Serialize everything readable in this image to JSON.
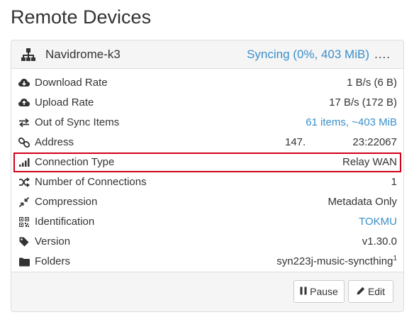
{
  "page": {
    "title": "Remote Devices"
  },
  "device": {
    "name": "Navidrome-k3",
    "status": "Syncing (0%, 403 MiB)",
    "status_more": "...."
  },
  "rows": [
    {
      "icon": "cloud-download-icon",
      "label": "Download Rate",
      "value": "1 B/s (6 B)"
    },
    {
      "icon": "cloud-upload-icon",
      "label": "Upload Rate",
      "value": "17 B/s (172 B)"
    },
    {
      "icon": "exchange-arrows-icon",
      "label": "Out of Sync Items",
      "value": "61 items, ~403 MiB"
    },
    {
      "icon": "link-icon",
      "label": "Address",
      "value_a": "147.",
      "value": "23:22067"
    },
    {
      "icon": "signal-bars-icon",
      "label": "Connection Type",
      "value": "Relay WAN"
    },
    {
      "icon": "shuffle-icon",
      "label": "Number of Connections",
      "value": "1"
    },
    {
      "icon": "compress-icon",
      "label": "Compression",
      "value": "Metadata Only"
    },
    {
      "icon": "qrcode-icon",
      "label": "Identification",
      "value": "TOKMU"
    },
    {
      "icon": "tag-icon",
      "label": "Version",
      "value": "v1.30.0"
    },
    {
      "icon": "folder-icon",
      "label": "Folders",
      "value": "syn223j-music-syncthing",
      "sup": "1"
    }
  ],
  "buttons": {
    "pause": "Pause",
    "edit": "Edit"
  },
  "colors": {
    "link": "#3a8fc9",
    "highlight": "#d0021b",
    "panel_bg": "#f5f5f5"
  }
}
